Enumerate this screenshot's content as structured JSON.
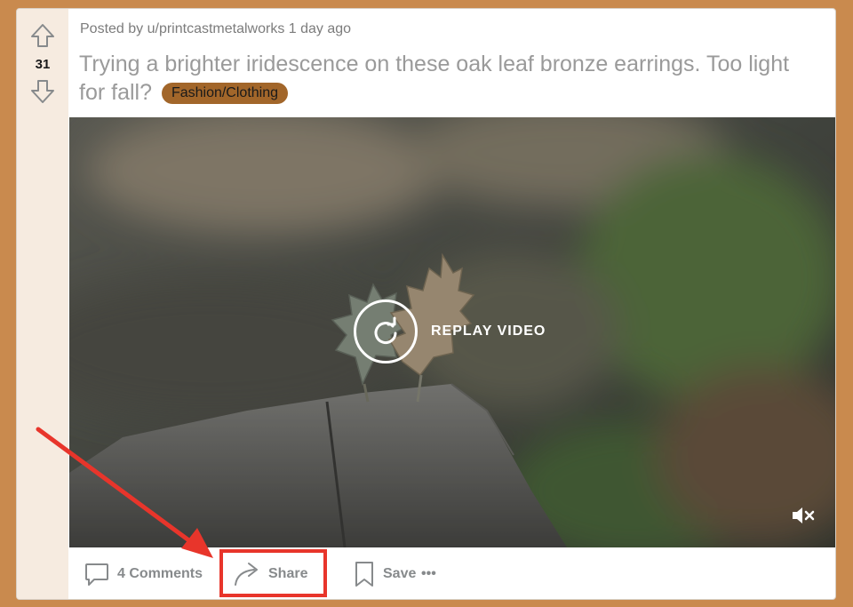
{
  "post": {
    "score": "31",
    "meta": "Posted by u/printcastmetalworks 1 day ago",
    "title": "Trying a brighter iridescence on these oak leaf bronze earrings. Too light for fall?",
    "flair": "Fashion/Clothing"
  },
  "video": {
    "replay_label": "REPLAY VIDEO"
  },
  "actions": {
    "comments_label": "4 Comments",
    "share_label": "Share",
    "save_label": "Save",
    "more_label": "•••"
  },
  "colors": {
    "page_background": "#c98a4e",
    "vote_column": "#f6ebe0",
    "flair": "#a2662a",
    "highlight": "#e8352b"
  },
  "icons": {
    "upvote": "arrow-up-icon",
    "downvote": "arrow-down-icon",
    "replay": "replay-icon",
    "mute": "muted-speaker-icon",
    "comments": "comment-bubble-icon",
    "share": "share-arrow-icon",
    "save": "bookmark-icon"
  }
}
